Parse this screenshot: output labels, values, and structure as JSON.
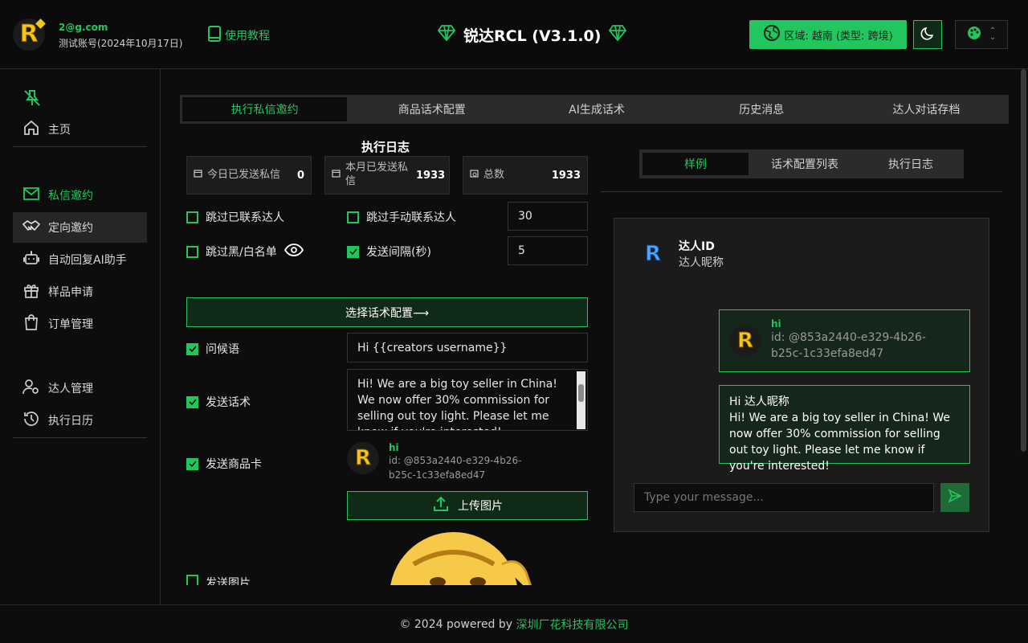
{
  "header": {
    "user_email": "2@g.com",
    "user_account": "测试账号(2024年10月17日)",
    "tutorial_label": "使用教程",
    "app_title": "锐达RCL (V3.1.0)",
    "region_label": "区域: 越南 (类型: 跨境)"
  },
  "sidebar": {
    "home": "主页",
    "dm_invite": "私信邀约",
    "targeted_invite": "定向邀约",
    "auto_reply": "自动回复AI助手",
    "sample_request": "样品申请",
    "order_mgmt": "订单管理",
    "creator_mgmt": "达人管理",
    "exec_calendar": "执行日历"
  },
  "tabs": [
    "执行私信邀约",
    "商品话术配置",
    "AI生成话术",
    "历史消息",
    "达人对话存档"
  ],
  "log": {
    "title": "执行日志",
    "today_label": "今日已发送私信",
    "today_value": "0",
    "month_label": "本月已发送私信",
    "month_value": "1933",
    "total_label": "总数",
    "total_value": "1933"
  },
  "options": {
    "skip_contacted": "跳过已联系达人",
    "skip_manual": "跳过手动联系达人",
    "manual_value": "30",
    "skip_blacklist": "跳过黑/白名单",
    "send_interval": "发送间隔(秒)",
    "interval_value": "5"
  },
  "config": {
    "choose_label": "选择话术配置⟶",
    "greeting_label": "问候语",
    "greeting_value": "Hi {{creators username}}",
    "script_label": "发送话术",
    "script_value": "Hi! We are a big toy seller in China! We now offer 30% commission for selling out toy light. Please let me know if you're interested!",
    "product_label": "发送商品卡",
    "product_name": "hi",
    "product_id": "id: @853a2440-e329-4b26-b25c-1c33efa8ed47",
    "upload_label": "上传图片",
    "image_label": "发送图片"
  },
  "preview": {
    "subtabs": [
      "样例",
      "话术配置列表",
      "执行日志"
    ],
    "creator_id": "达人ID",
    "creator_nick": "达人昵称",
    "card_name": "hi",
    "card_id": "id: @853a2440-e329-4b26-b25c-1c33efa8ed47",
    "message_greeting": "Hi 达人昵称",
    "message_body": "Hi! We are a big toy seller in China! We now offer 30% commission for selling out toy light. Please let me know if you're interested!",
    "input_placeholder": "Type your message..."
  },
  "footer": {
    "prefix": "© 2024 powered by ",
    "company": "深圳厂花科技有限公司"
  },
  "colors": {
    "accent": "#22c55e",
    "background": "#0d0d0d",
    "panel": "#1c1b1a"
  }
}
